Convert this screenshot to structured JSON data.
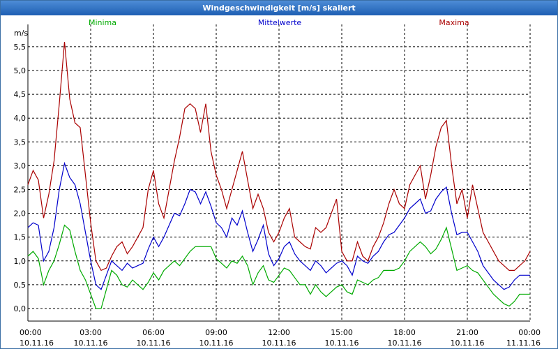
{
  "window": {
    "title": "Windgeschwindigkeit [m/s] skaliert"
  },
  "chart_data": {
    "type": "line",
    "title": "Windgeschwindigkeit [m/s] skaliert",
    "ylabel": "m/s",
    "xlabel": "",
    "ylim": [
      0,
      5.75
    ],
    "xlim": [
      0,
      24
    ],
    "grid": true,
    "legend_placement": "top",
    "yticks": [
      "0,0",
      "0,5",
      "1,0",
      "1,5",
      "2,0",
      "2,5",
      "3,0",
      "3,5",
      "4,0",
      "4,5",
      "5,0",
      "5,5"
    ],
    "xticks": [
      {
        "time": "00:00",
        "date": "10.11.16"
      },
      {
        "time": "03:00",
        "date": "10.11.16"
      },
      {
        "time": "06:00",
        "date": "10.11.16"
      },
      {
        "time": "09:00",
        "date": "10.11.16"
      },
      {
        "time": "12:00",
        "date": "10.11.16"
      },
      {
        "time": "15:00",
        "date": "10.11.16"
      },
      {
        "time": "18:00",
        "date": "10.11.16"
      },
      {
        "time": "21:00",
        "date": "10.11.16"
      },
      {
        "time": "00:00",
        "date": "11.11.16"
      }
    ],
    "series": [
      {
        "name": "Minima",
        "color": "#00aa00",
        "x": [
          0,
          0.25,
          0.5,
          0.75,
          1,
          1.25,
          1.5,
          1.75,
          2,
          2.25,
          2.5,
          2.75,
          3,
          3.25,
          3.5,
          3.75,
          4,
          4.25,
          4.5,
          4.75,
          5,
          5.25,
          5.5,
          5.75,
          6,
          6.25,
          6.5,
          6.75,
          7,
          7.25,
          7.5,
          7.75,
          8,
          8.25,
          8.5,
          8.75,
          9,
          9.25,
          9.5,
          9.75,
          10,
          10.25,
          10.5,
          10.75,
          11,
          11.25,
          11.5,
          11.75,
          12,
          12.25,
          12.5,
          12.75,
          13,
          13.25,
          13.5,
          13.75,
          14,
          14.25,
          14.5,
          14.75,
          15,
          15.25,
          15.5,
          15.75,
          16,
          16.25,
          16.5,
          16.75,
          17,
          17.25,
          17.5,
          17.75,
          18,
          18.25,
          18.5,
          18.75,
          19,
          19.25,
          19.5,
          19.75,
          20,
          20.25,
          20.5,
          20.75,
          21,
          21.25,
          21.5,
          21.75,
          22,
          22.25,
          22.5,
          22.75,
          23,
          23.25,
          23.5,
          23.75,
          24
        ],
        "values": [
          1.1,
          1.2,
          1.05,
          0.5,
          0.8,
          1.0,
          1.35,
          1.75,
          1.65,
          1.2,
          0.8,
          0.6,
          0.3,
          0.0,
          0.0,
          0.4,
          0.8,
          0.7,
          0.5,
          0.45,
          0.6,
          0.5,
          0.4,
          0.55,
          0.75,
          0.6,
          0.8,
          0.9,
          1.0,
          0.9,
          1.05,
          1.2,
          1.3,
          1.3,
          1.3,
          1.3,
          1.05,
          0.95,
          0.85,
          1.0,
          0.95,
          1.1,
          0.9,
          0.5,
          0.75,
          0.9,
          0.6,
          0.55,
          0.7,
          0.85,
          0.8,
          0.65,
          0.5,
          0.5,
          0.3,
          0.5,
          0.35,
          0.25,
          0.35,
          0.45,
          0.5,
          0.35,
          0.3,
          0.6,
          0.55,
          0.5,
          0.6,
          0.65,
          0.8,
          0.8,
          0.8,
          0.85,
          1.0,
          1.2,
          1.3,
          1.4,
          1.3,
          1.15,
          1.25,
          1.45,
          1.7,
          1.25,
          0.8,
          0.85,
          0.9,
          0.8,
          0.75,
          0.6,
          0.45,
          0.3,
          0.2,
          0.1,
          0.05,
          0.15,
          0.3,
          0.3,
          0.3
        ]
      },
      {
        "name": "Mittelwerte",
        "color": "#0000cc",
        "x": [
          0,
          0.25,
          0.5,
          0.75,
          1,
          1.25,
          1.5,
          1.75,
          2,
          2.25,
          2.5,
          2.75,
          3,
          3.25,
          3.5,
          3.75,
          4,
          4.25,
          4.5,
          4.75,
          5,
          5.25,
          5.5,
          5.75,
          6,
          6.25,
          6.5,
          6.75,
          7,
          7.25,
          7.5,
          7.75,
          8,
          8.25,
          8.5,
          8.75,
          9,
          9.25,
          9.5,
          9.75,
          10,
          10.25,
          10.5,
          10.75,
          11,
          11.25,
          11.5,
          11.75,
          12,
          12.25,
          12.5,
          12.75,
          13,
          13.25,
          13.5,
          13.75,
          14,
          14.25,
          14.5,
          14.75,
          15,
          15.25,
          15.5,
          15.75,
          16,
          16.25,
          16.5,
          16.75,
          17,
          17.25,
          17.5,
          17.75,
          18,
          18.25,
          18.5,
          18.75,
          19,
          19.25,
          19.5,
          19.75,
          20,
          20.25,
          20.5,
          20.75,
          21,
          21.25,
          21.5,
          21.75,
          22,
          22.25,
          22.5,
          22.75,
          23,
          23.25,
          23.5,
          23.75,
          24
        ],
        "values": [
          1.7,
          1.8,
          1.75,
          1.0,
          1.2,
          1.7,
          2.5,
          3.05,
          2.75,
          2.6,
          2.2,
          1.6,
          1.0,
          0.5,
          0.4,
          0.7,
          1.0,
          0.9,
          0.8,
          0.95,
          0.85,
          0.9,
          0.95,
          1.25,
          1.5,
          1.3,
          1.5,
          1.75,
          2.0,
          1.95,
          2.2,
          2.5,
          2.45,
          2.2,
          2.45,
          2.15,
          1.8,
          1.7,
          1.5,
          1.9,
          1.75,
          2.05,
          1.6,
          1.2,
          1.45,
          1.75,
          1.15,
          0.9,
          1.05,
          1.3,
          1.4,
          1.15,
          1.0,
          0.9,
          0.8,
          1.0,
          0.9,
          0.75,
          0.85,
          0.95,
          1.0,
          0.9,
          0.7,
          1.1,
          1.0,
          0.95,
          1.1,
          1.2,
          1.4,
          1.55,
          1.6,
          1.75,
          1.9,
          2.1,
          2.2,
          2.3,
          2.0,
          2.05,
          2.3,
          2.45,
          2.55,
          2.0,
          1.55,
          1.6,
          1.6,
          1.4,
          1.2,
          0.9,
          0.75,
          0.6,
          0.5,
          0.4,
          0.45,
          0.6,
          0.7,
          0.7,
          0.7
        ]
      },
      {
        "name": "Maxima",
        "color": "#aa0000",
        "x": [
          0,
          0.25,
          0.5,
          0.75,
          1,
          1.25,
          1.5,
          1.75,
          2,
          2.25,
          2.5,
          2.75,
          3,
          3.25,
          3.5,
          3.75,
          4,
          4.25,
          4.5,
          4.75,
          5,
          5.25,
          5.5,
          5.75,
          6,
          6.25,
          6.5,
          6.75,
          7,
          7.25,
          7.5,
          7.75,
          8,
          8.25,
          8.5,
          8.75,
          9,
          9.25,
          9.5,
          9.75,
          10,
          10.25,
          10.5,
          10.75,
          11,
          11.25,
          11.5,
          11.75,
          12,
          12.25,
          12.5,
          12.75,
          13,
          13.25,
          13.5,
          13.75,
          14,
          14.25,
          14.5,
          14.75,
          15,
          15.25,
          15.5,
          15.75,
          16,
          16.25,
          16.5,
          16.75,
          17,
          17.25,
          17.5,
          17.75,
          18,
          18.25,
          18.5,
          18.75,
          19,
          19.25,
          19.5,
          19.75,
          20,
          20.25,
          20.5,
          20.75,
          21,
          21.25,
          21.5,
          21.75,
          22,
          22.25,
          22.5,
          22.75,
          23,
          23.25,
          23.5,
          23.75,
          24
        ],
        "values": [
          2.6,
          2.9,
          2.7,
          1.9,
          2.4,
          3.1,
          4.3,
          5.6,
          4.4,
          3.9,
          3.8,
          2.8,
          1.8,
          1.0,
          0.8,
          0.85,
          1.1,
          1.3,
          1.4,
          1.15,
          1.3,
          1.5,
          1.7,
          2.5,
          2.9,
          2.2,
          1.9,
          2.5,
          3.1,
          3.6,
          4.2,
          4.3,
          4.2,
          3.7,
          4.3,
          3.3,
          2.8,
          2.5,
          2.1,
          2.5,
          2.9,
          3.3,
          2.7,
          2.1,
          2.4,
          2.1,
          1.6,
          1.4,
          1.6,
          1.9,
          2.1,
          1.5,
          1.4,
          1.3,
          1.25,
          1.7,
          1.6,
          1.7,
          2.0,
          2.3,
          1.2,
          1.0,
          1.0,
          1.4,
          1.1,
          1.0,
          1.3,
          1.5,
          1.8,
          2.2,
          2.5,
          2.2,
          2.1,
          2.6,
          2.8,
          3.0,
          2.3,
          2.8,
          3.4,
          3.8,
          3.95,
          3.0,
          2.2,
          2.5,
          1.9,
          2.6,
          2.1,
          1.6,
          1.4,
          1.2,
          1.0,
          0.9,
          0.8,
          0.8,
          0.9,
          1.0,
          1.2
        ]
      }
    ]
  }
}
